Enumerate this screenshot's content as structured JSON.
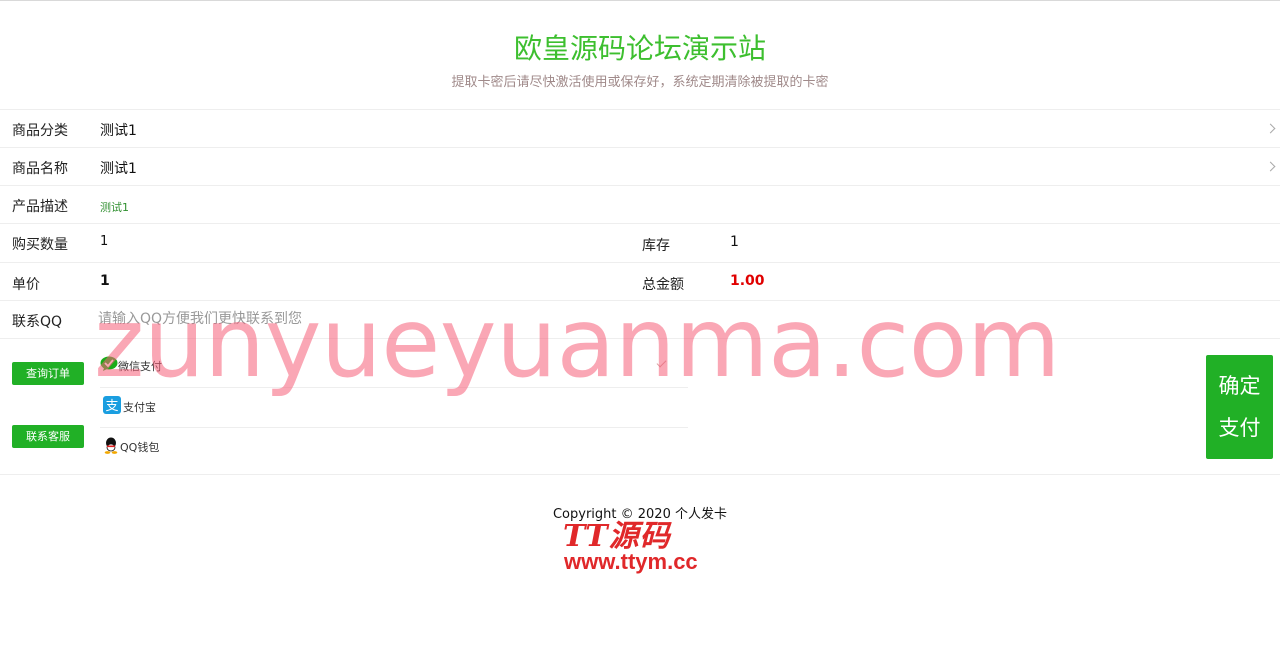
{
  "header": {
    "title": "欧皇源码论坛演示站",
    "subtitle": "提取卡密后请尽快激活使用或保存好，系统定期清除被提取的卡密"
  },
  "form": {
    "category": {
      "label": "商品分类",
      "value": "测试1"
    },
    "product": {
      "label": "商品名称",
      "value": "测试1"
    },
    "description": {
      "label": "产品描述",
      "value": "测试1"
    },
    "quantity": {
      "label": "购买数量",
      "value": "1"
    },
    "stock": {
      "label": "库存",
      "value": "1"
    },
    "unit_price": {
      "label": "单价",
      "value": "1"
    },
    "total": {
      "label": "总金额",
      "value": "1.00"
    },
    "contact_qq": {
      "label": "联系QQ",
      "placeholder": "请输入QQ方便我们更快联系到您"
    }
  },
  "buttons": {
    "query_order": "查询订单",
    "contact_service": "联系客服",
    "confirm_pay_line1": "确定",
    "confirm_pay_line2": "支付"
  },
  "payment_methods": [
    {
      "name": "微信支付",
      "icon": "wechat-pay-icon",
      "selected": true
    },
    {
      "name": "支付宝",
      "icon": "alipay-icon",
      "selected": false
    },
    {
      "name": "QQ钱包",
      "icon": "qq-wallet-icon",
      "selected": false
    }
  ],
  "footer": {
    "copyright": "Copyright © 2020 个人发卡",
    "logo_text": "TT源码",
    "logo_url": "www.ttym.cc"
  },
  "watermark": "zunyueyuanma.com",
  "colors": {
    "brand_green": "#3dbf2f",
    "button_green": "#21b026",
    "total_red": "#e00000",
    "watermark_pink": "#f65f78"
  }
}
